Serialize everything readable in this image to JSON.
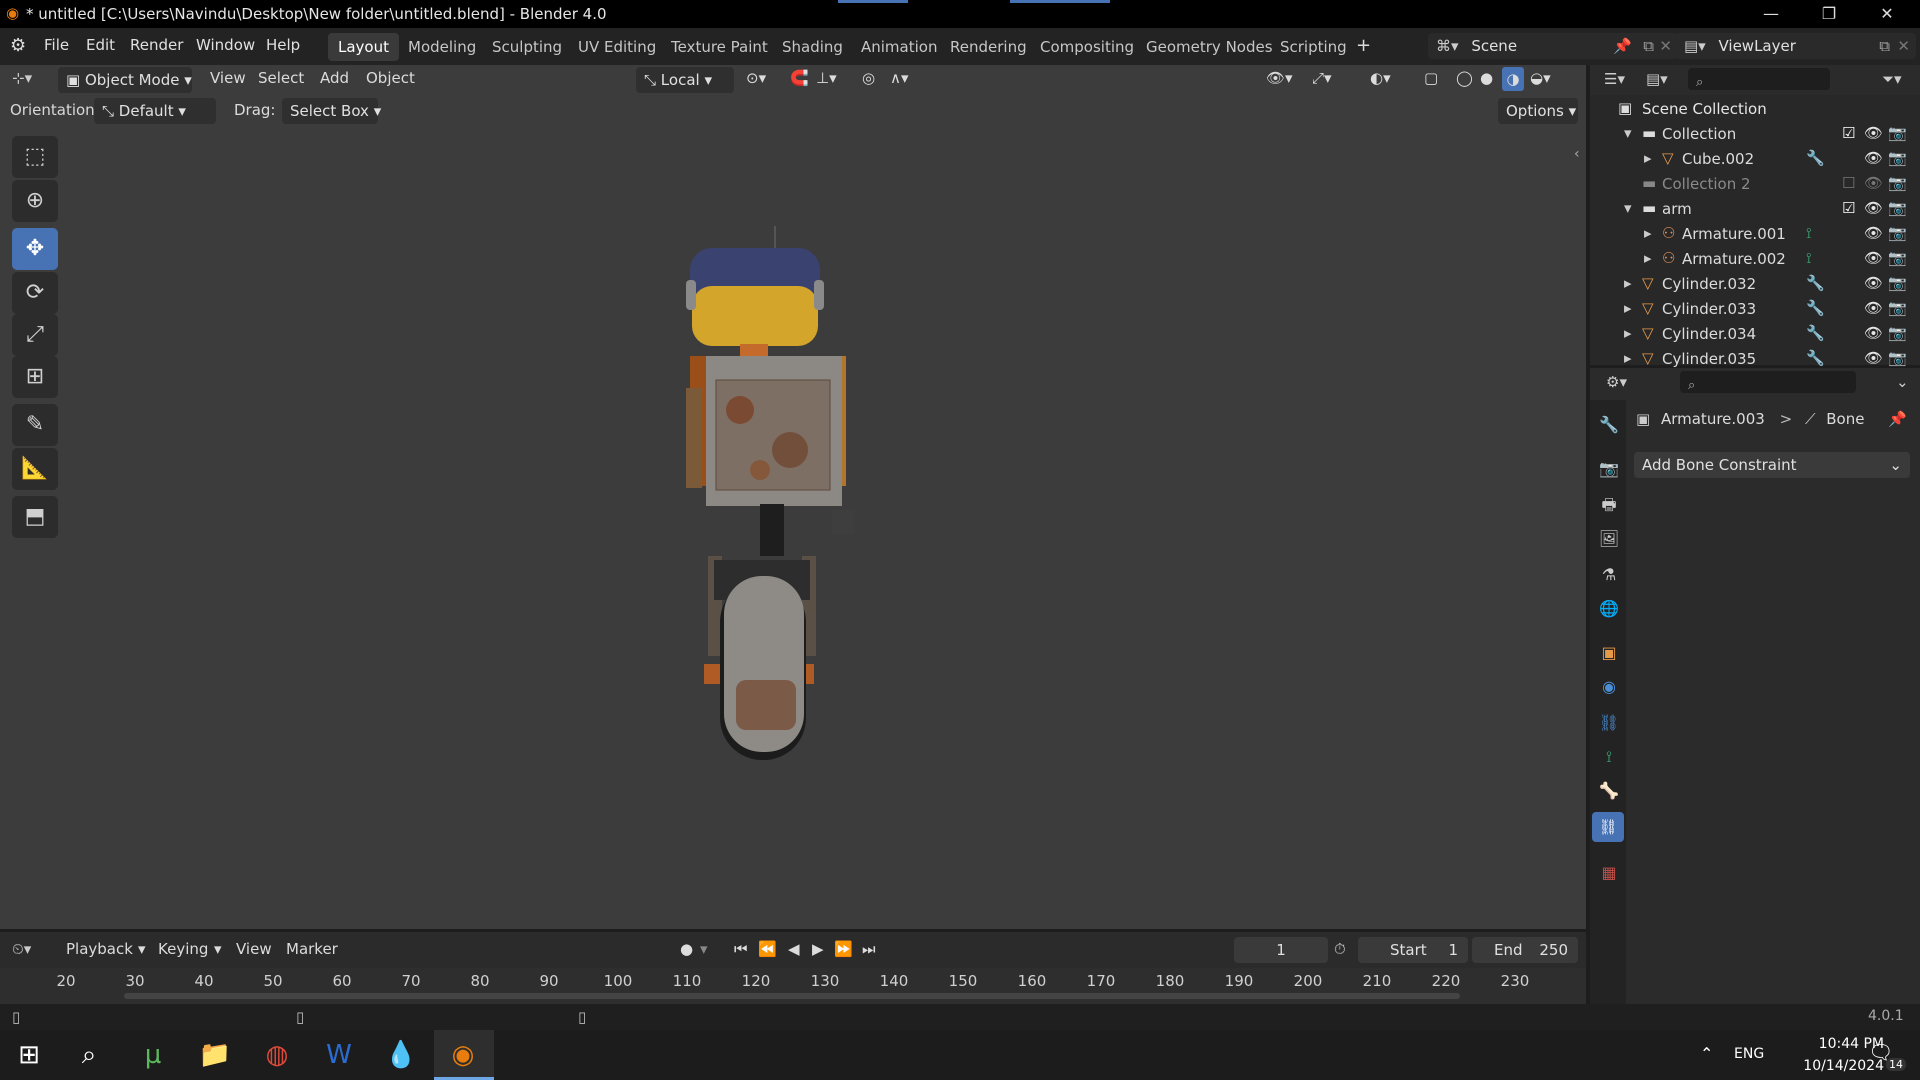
{
  "titlebar": {
    "title": "* untitled [C:\\Users\\Navindu\\Desktop\\New folder\\untitled.blend] - Blender 4.0",
    "minimize": "—",
    "restore": "❐",
    "close": "✕"
  },
  "menu": {
    "items": [
      "File",
      "Edit",
      "Render",
      "Window",
      "Help"
    ]
  },
  "workspaces": {
    "tabs": [
      "Layout",
      "Modeling",
      "Sculpting",
      "UV Editing",
      "Texture Paint",
      "Shading",
      "Animation",
      "Rendering",
      "Compositing",
      "Geometry Nodes",
      "Scripting"
    ],
    "active": "Layout",
    "add": "+"
  },
  "scene": {
    "label": "Scene"
  },
  "viewlayer": {
    "label": "ViewLayer"
  },
  "viewport_header": {
    "mode": "Object Mode",
    "menus": [
      "View",
      "Select",
      "Add",
      "Object"
    ],
    "transform_orientation": "Local",
    "orientation_label": "Orientation:",
    "orientation_value": "Default",
    "drag_label": "Drag:",
    "drag_value": "Select Box",
    "options": "Options"
  },
  "outliner": {
    "root": "Scene Collection",
    "rows": [
      {
        "name": "Collection",
        "indent": 1,
        "expanded": "▾",
        "type": "collection",
        "dim": false
      },
      {
        "name": "Cube.002",
        "indent": 2,
        "expanded": "▸",
        "type": "mesh",
        "dim": false
      },
      {
        "name": "Collection 2",
        "indent": 1,
        "expanded": "",
        "type": "collection",
        "dim": true
      },
      {
        "name": "arm",
        "indent": 1,
        "expanded": "▾",
        "type": "collection",
        "dim": false
      },
      {
        "name": "Armature.001",
        "indent": 2,
        "expanded": "▸",
        "type": "armature",
        "dim": false
      },
      {
        "name": "Armature.002",
        "indent": 2,
        "expanded": "▸",
        "type": "armature",
        "dim": false
      },
      {
        "name": "Cylinder.032",
        "indent": 1,
        "expanded": "▸",
        "type": "mesh",
        "dim": false
      },
      {
        "name": "Cylinder.033",
        "indent": 1,
        "expanded": "▸",
        "type": "mesh",
        "dim": false
      },
      {
        "name": "Cylinder.034",
        "indent": 1,
        "expanded": "▸",
        "type": "mesh",
        "dim": false
      },
      {
        "name": "Cylinder.035",
        "indent": 1,
        "expanded": "▸",
        "type": "mesh",
        "dim": false
      }
    ]
  },
  "properties": {
    "breadcrumb_object": "Armature.003",
    "breadcrumb_sep": ">",
    "breadcrumb_bone": "Bone",
    "add_constraint": "Add Bone Constraint"
  },
  "timeline": {
    "menus": [
      "Playback",
      "Keying",
      "View",
      "Marker"
    ],
    "current_frame": "1",
    "start_label": "Start",
    "start_value": "1",
    "end_label": "End",
    "end_value": "250",
    "ticks": [
      "20",
      "30",
      "40",
      "50",
      "60",
      "70",
      "80",
      "90",
      "100",
      "110",
      "120",
      "130",
      "140",
      "150",
      "160",
      "170",
      "180",
      "190",
      "200",
      "210",
      "220",
      "230"
    ]
  },
  "status": {
    "version": "4.0.1"
  },
  "taskbar": {
    "lang": "ENG",
    "time": "10:44 PM",
    "date": "10/14/2024",
    "notifications": "14"
  },
  "colors": {
    "accent": "#4772b3",
    "viewport_bg": "#3c3c3c",
    "header_bg": "#232323",
    "mesh_icon": "#e59a4a",
    "armature_icon": "#e0935c"
  }
}
